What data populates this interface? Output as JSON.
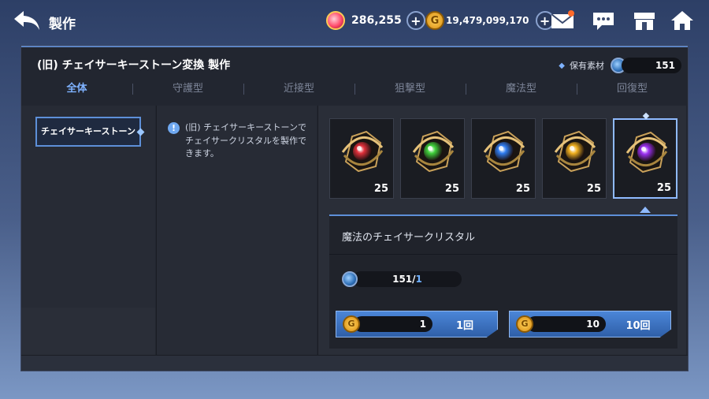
{
  "header": {
    "title": "製作",
    "back_icon": "back-arrow-icon"
  },
  "currencies": {
    "gem": {
      "icon": "red-gem-icon",
      "value": "286,255"
    },
    "gold": {
      "icon": "gold-coin-icon",
      "symbol": "G",
      "value": "19,479,099,170"
    }
  },
  "top_icons": [
    "mail-icon",
    "chat-icon",
    "shop-icon",
    "home-icon"
  ],
  "panel": {
    "title": "(旧) チェイサーキーストーン変換 製作",
    "owned_label": "保有素材",
    "owned_count": "151"
  },
  "tabs": [
    "全体",
    "守護型",
    "近接型",
    "狙撃型",
    "魔法型",
    "回復型"
  ],
  "category": {
    "label": "チェイサーキーストーン"
  },
  "info_text": "(旧) チェイサーキーストーンでチェイサークリスタルを製作できます。",
  "items": [
    {
      "color": "#e0303a",
      "qty": "25"
    },
    {
      "color": "#3fcf3a",
      "qty": "25"
    },
    {
      "color": "#2f7cf0",
      "qty": "25"
    },
    {
      "color": "#f0b020",
      "qty": "25"
    },
    {
      "color": "#9a2ff0",
      "qty": "25"
    }
  ],
  "detail": {
    "name": "魔法のチェイサークリスタル",
    "have": "151",
    "sep": "/",
    "need": "1"
  },
  "craft_buttons": [
    {
      "cost": "1",
      "label": "1回"
    },
    {
      "cost": "10",
      "label": "10回"
    }
  ],
  "colors": {
    "accent": "#5d8fd8",
    "tab_active": "#7fb2ff"
  }
}
